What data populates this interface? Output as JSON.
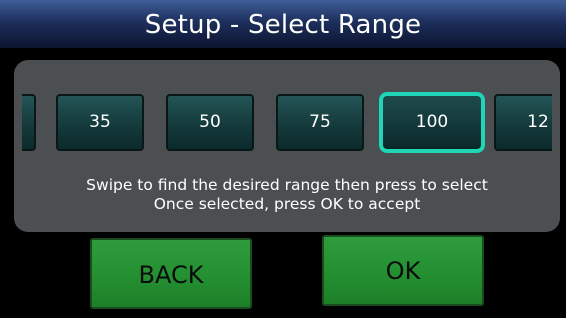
{
  "header": {
    "title": "Setup - Select Range"
  },
  "range_selector": {
    "options": [
      "",
      "35",
      "50",
      "75",
      "100",
      "12"
    ],
    "selected_value": "100"
  },
  "instructions": {
    "line1": "Swipe to find the desired range then press to select",
    "line2": "Once selected, press OK to accept"
  },
  "actions": {
    "back_label": "BACK",
    "ok_label": "OK"
  },
  "colors": {
    "header_bg": "#1d2f5c",
    "panel_bg": "#4b4f52",
    "range_button_bg": "#163c3e",
    "selected_highlight": "#1fd6b6",
    "action_button_bg": "#249132"
  }
}
